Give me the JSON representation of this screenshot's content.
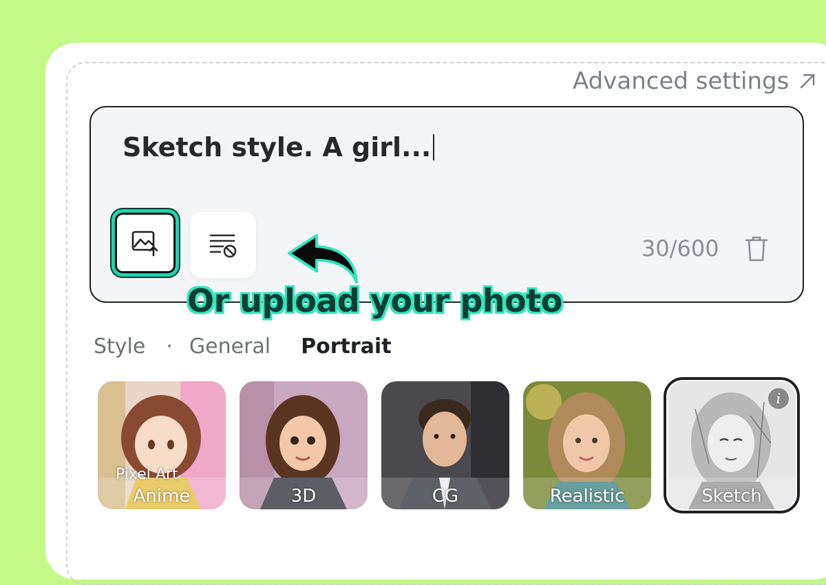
{
  "header": {
    "advanced_settings_label": "Advanced settings",
    "advanced_icon": "external-arrow-icon"
  },
  "prompt": {
    "text": "Sketch style. A girl...",
    "counter": "30/600",
    "upload_icon": "image-upload-icon",
    "negative_prompt_icon": "negative-prompt-icon",
    "clear_icon": "trash-icon"
  },
  "callout": {
    "text": "Or upload your photo",
    "color": "#2fe6bd"
  },
  "style_bar": {
    "label": "Style",
    "separator": "·",
    "tabs": [
      {
        "label": "General",
        "active": false
      },
      {
        "label": "Portrait",
        "active": true
      }
    ]
  },
  "styles": [
    {
      "label": "Anime",
      "sublabel": "Pixel Art",
      "selected": false
    },
    {
      "label": "3D",
      "selected": false
    },
    {
      "label": "CG",
      "selected": false
    },
    {
      "label": "Realistic",
      "selected": false
    },
    {
      "label": "Sketch",
      "selected": true,
      "info": "i"
    }
  ],
  "colors": {
    "background": "#c4f987",
    "accent": "#1cd4b0"
  }
}
